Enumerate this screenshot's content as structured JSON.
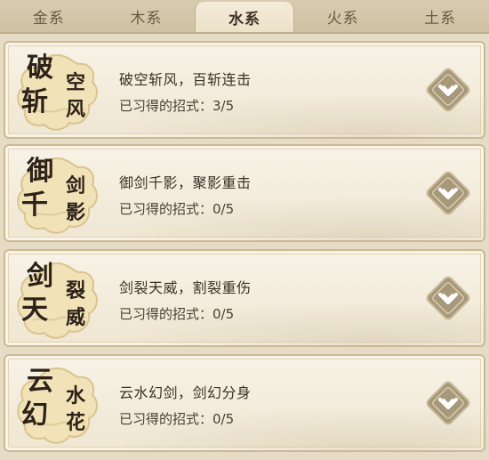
{
  "tabs": [
    {
      "label": "金系",
      "active": false
    },
    {
      "label": "木系",
      "active": false
    },
    {
      "label": "水系",
      "active": true
    },
    {
      "label": "火系",
      "active": false
    },
    {
      "label": "土系",
      "active": false
    }
  ],
  "skills": [
    {
      "emblem": [
        "破",
        "斩",
        "空",
        "风"
      ],
      "name": "破空斩风，百斩连击",
      "learned_label": "已习得的招式：",
      "learned": "3/5"
    },
    {
      "emblem": [
        "御",
        "千",
        "剑",
        "影"
      ],
      "name": "御剑千影，聚影重击",
      "learned_label": "已习得的招式：",
      "learned": "0/5"
    },
    {
      "emblem": [
        "剑",
        "天",
        "裂",
        "威"
      ],
      "name": "剑裂天威，割裂重伤",
      "learned_label": "已习得的招式：",
      "learned": "0/5"
    },
    {
      "emblem": [
        "云",
        "幻",
        "水",
        "花"
      ],
      "name": "云水幻剑，剑幻分身",
      "learned_label": "已习得的招式：",
      "learned": "0/5"
    }
  ],
  "colors": {
    "accent": "#8c7a4e",
    "button_fill": "#a8987a",
    "emblem_fill": "#f1e2b8"
  },
  "icons": {
    "expand": "chevron-down-icon",
    "emblem": "cloud-medallion-icon"
  }
}
